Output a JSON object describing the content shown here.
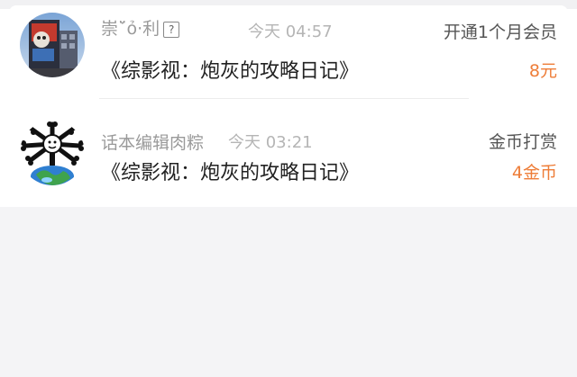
{
  "gifts": [
    {
      "username": "崇ˇ̈ỏ·利",
      "time": "今天 04:57",
      "title": "《综影视：炮灰的攻略日记》",
      "action": "开通1个月会员",
      "amount": "8元",
      "help_icon": "?"
    },
    {
      "username": "话本编辑肉粽",
      "time": "今天 03:21",
      "title": "《综影视：炮灰的攻略日记》",
      "action": "金币打赏",
      "amount": "4金币"
    }
  ],
  "colors": {
    "accent": "#ee7d38",
    "muted_text": "#9a9a9a",
    "title_text": "#222222",
    "background": "#f4f4f6"
  }
}
